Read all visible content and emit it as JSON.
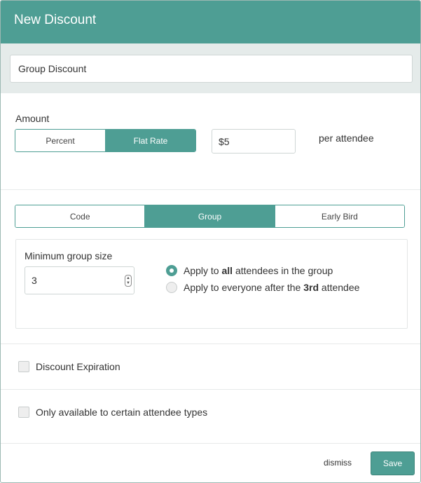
{
  "modal": {
    "title": "New Discount"
  },
  "name_field": {
    "value": "Group Discount"
  },
  "amount": {
    "label": "Amount",
    "options": [
      "Percent",
      "Flat Rate"
    ],
    "selected": "Flat Rate",
    "value": "$5",
    "suffix": "per attendee"
  },
  "discount_type": {
    "options": [
      "Code",
      "Group",
      "Early Bird"
    ],
    "selected": "Group"
  },
  "group": {
    "min_size_label": "Minimum group size",
    "min_size_value": "3",
    "apply_all": {
      "before": "Apply to ",
      "bold": "all",
      "after": " attendees in the group",
      "checked": true
    },
    "apply_after": {
      "before": "Apply to everyone after the ",
      "bold": "3rd",
      "after": " attendee",
      "checked": false
    }
  },
  "expiration": {
    "label": "Discount Expiration",
    "checked": false
  },
  "attendee_types": {
    "label": "Only available to certain attendee types",
    "checked": false
  },
  "footer": {
    "dismiss_label": "dismiss",
    "save_label": "Save"
  },
  "colors": {
    "accent": "#4e9e94",
    "band": "#e5ebea"
  }
}
